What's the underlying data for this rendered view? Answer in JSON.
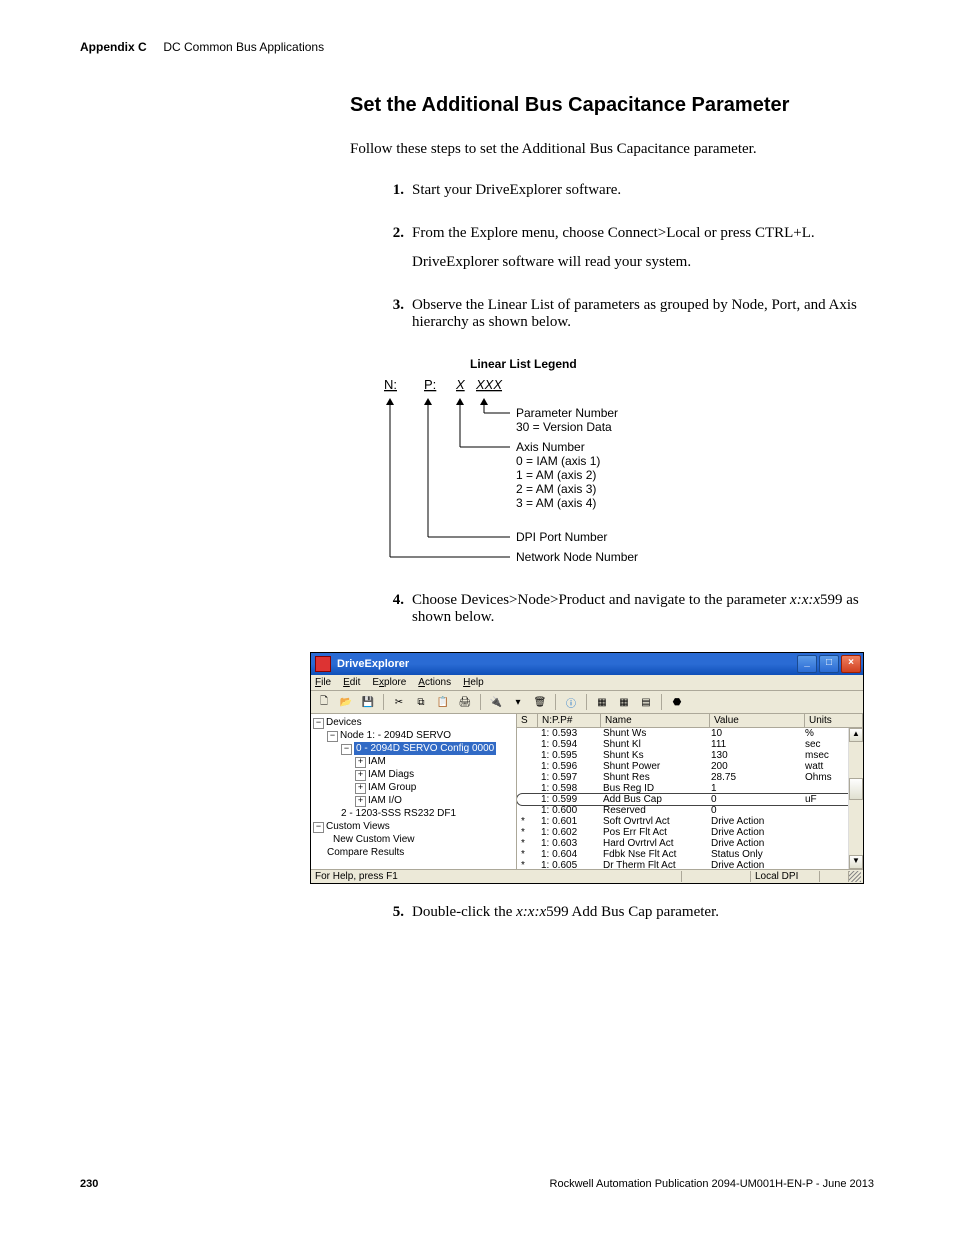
{
  "header": {
    "appendix": "Appendix C",
    "title": "DC Common Bus Applications"
  },
  "section_title": "Set the Additional Bus Capacitance Parameter",
  "intro": "Follow these steps to set the Additional Bus Capacitance parameter.",
  "steps": {
    "s1": "Start your DriveExplorer software.",
    "s2": "From the Explore menu, choose Connect>Local or press CTRL+L.",
    "s2b": "DriveExplorer software will read your system.",
    "s3": "Observe the Linear List of parameters as grouped by Node, Port, and Axis hierarchy as shown below.",
    "s4a": "Choose Devices>Node>Product and navigate to the parameter ",
    "s4b": "x:x:x",
    "s4c": "599 as shown below.",
    "s5a": "Double-click the ",
    "s5b": "x:x:x",
    "s5c": "599 Add Bus Cap parameter."
  },
  "legend": {
    "title": "Linear List Legend",
    "npx": {
      "n": "N:",
      "p": "P:",
      "x": "X",
      "xxx": "XXX"
    },
    "labels": {
      "param_num": "Parameter Number",
      "param_num2": "30 = Version Data",
      "axis": "Axis Number",
      "axis0": "0 = IAM (axis 1)",
      "axis1": "1 = AM (axis 2)",
      "axis2": "2 = AM (axis 3)",
      "axis3": "3 = AM (axis 4)",
      "dpi": "DPI Port Number",
      "node": "Network Node Number"
    }
  },
  "app": {
    "title": "DriveExplorer",
    "menu": {
      "file": "File",
      "edit": "Edit",
      "explore": "Explore",
      "actions": "Actions",
      "help": "Help"
    },
    "tree": {
      "devices": "Devices",
      "node1": "Node 1: - 2094D SERVO",
      "config": "0 - 2094D SERVO Config 0000",
      "iam": "IAM",
      "iam_diags": "IAM Diags",
      "iam_group": "IAM Group",
      "iam_io": "IAM I/O",
      "port2": "2 - 1203-SSS RS232 DF1",
      "custom": "Custom Views",
      "newcustom": "New Custom View",
      "compare": "Compare Results"
    },
    "cols": {
      "s": "S",
      "np": "N:P.P#",
      "name": "Name",
      "value": "Value",
      "units": "Units"
    },
    "rows": [
      {
        "s": "",
        "np": "1: 0.593",
        "name": "Shunt Ws",
        "value": "10",
        "units": "%"
      },
      {
        "s": "",
        "np": "1: 0.594",
        "name": "Shunt Kl",
        "value": "111",
        "units": "sec"
      },
      {
        "s": "",
        "np": "1: 0.595",
        "name": "Shunt Ks",
        "value": "130",
        "units": "msec"
      },
      {
        "s": "",
        "np": "1: 0.596",
        "name": "Shunt Power",
        "value": "200",
        "units": "watt"
      },
      {
        "s": "",
        "np": "1: 0.597",
        "name": "Shunt Res",
        "value": "28.75",
        "units": "Ohms"
      },
      {
        "s": "",
        "np": "1: 0.598",
        "name": "Bus Reg ID",
        "value": "1",
        "units": ""
      },
      {
        "s": "",
        "np": "1: 0.599",
        "name": "Add Bus Cap",
        "value": "0",
        "units": "uF"
      },
      {
        "s": "",
        "np": "1: 0.600",
        "name": "Reserved",
        "value": "0",
        "units": ""
      },
      {
        "s": "*",
        "np": "1: 0.601",
        "name": "Soft Ovrtrvl Act",
        "value": "Drive Action",
        "units": ""
      },
      {
        "s": "*",
        "np": "1: 0.602",
        "name": "Pos Err Flt Act",
        "value": "Drive Action",
        "units": ""
      },
      {
        "s": "*",
        "np": "1: 0.603",
        "name": "Hard Ovrtrvl Act",
        "value": "Drive Action",
        "units": ""
      },
      {
        "s": "*",
        "np": "1: 0.604",
        "name": "Fdbk Nse Flt Act",
        "value": "Status Only",
        "units": ""
      },
      {
        "s": "*",
        "np": "1: 0.605",
        "name": "Dr Therm Flt Act",
        "value": "Drive Action",
        "units": ""
      }
    ],
    "status": {
      "help": "For Help, press F1",
      "conn": "Local DPI"
    }
  },
  "footer": {
    "page": "230",
    "pub": "Rockwell Automation Publication 2094-UM001H-EN-P - June 2013"
  }
}
